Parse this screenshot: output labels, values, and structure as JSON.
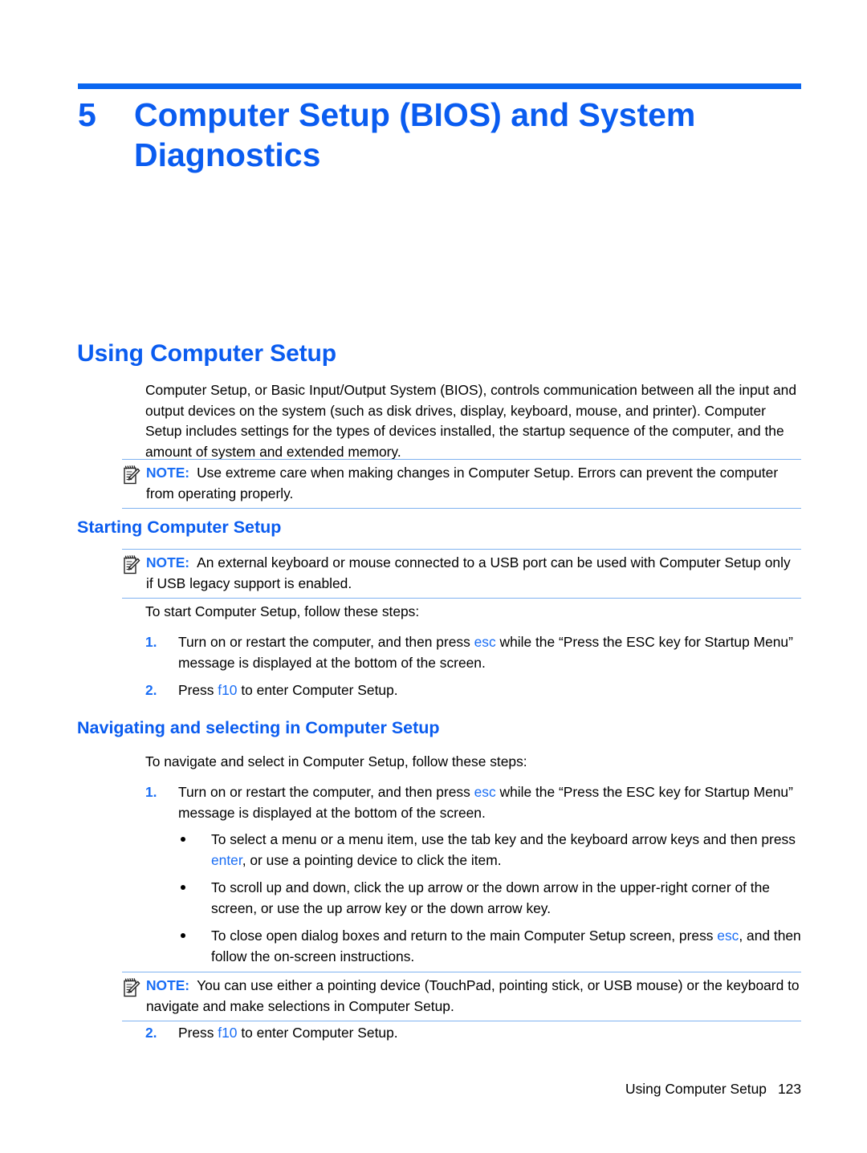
{
  "chapter": {
    "number": "5",
    "title": "Computer Setup (BIOS) and System Diagnostics"
  },
  "headings": {
    "using_computer_setup": "Using Computer Setup",
    "starting_computer_setup": "Starting Computer Setup",
    "navigating_and_selecting": "Navigating and selecting in Computer Setup"
  },
  "intro_paragraph": "Computer Setup, or Basic Input/Output System (BIOS), controls communication between all the input and output devices on the system (such as disk drives, display, keyboard, mouse, and printer). Computer Setup includes settings for the types of devices installed, the startup sequence of the computer, and the amount of system and extended memory.",
  "notes": {
    "label": "NOTE:",
    "note1": "Use extreme care when making changes in Computer Setup. Errors can prevent the computer from operating properly.",
    "note2": "An external keyboard or mouse connected to a USB port can be used with Computer Setup only if USB legacy support is enabled.",
    "note3": "You can use either a pointing device (TouchPad, pointing stick, or USB mouse) or the keyboard to navigate and make selections in Computer Setup."
  },
  "starting": {
    "lead_in": "To start Computer Setup, follow these steps:",
    "step1": {
      "num": "1.",
      "part_a": "Turn on or restart the computer, and then press ",
      "key": "esc",
      "part_b": " while the “Press the ESC key for Startup Menu” message is displayed at the bottom of the screen."
    },
    "step2": {
      "num": "2.",
      "part_a": "Press ",
      "key": "f10",
      "part_b": " to enter Computer Setup."
    }
  },
  "navigating": {
    "lead_in": "To navigate and select in Computer Setup, follow these steps:",
    "step1": {
      "num": "1.",
      "part_a": "Turn on or restart the computer, and then press ",
      "key": "esc",
      "part_b": " while the “Press the ESC key for Startup Menu” message is displayed at the bottom of the screen."
    },
    "bullets": [
      {
        "part_a": "To select a menu or a menu item, use the tab key and the keyboard arrow keys and then press ",
        "key": "enter",
        "part_b": ", or use a pointing device to click the item."
      },
      {
        "part_a": "To scroll up and down, click the up arrow or the down arrow in the upper-right corner of the screen, or use the up arrow key or the down arrow key.",
        "key": "",
        "part_b": ""
      },
      {
        "part_a": "To close open dialog boxes and return to the main Computer Setup screen, press ",
        "key": "esc",
        "part_b": ", and then follow the on-screen instructions."
      }
    ],
    "step2": {
      "num": "2.",
      "part_a": "Press ",
      "key": "f10",
      "part_b": " to enter Computer Setup."
    }
  },
  "footer": {
    "running_head": "Using Computer Setup",
    "page_number": "123"
  },
  "colors": {
    "heading_blue": "#0a5cf0",
    "key_blue": "#1a6ef5",
    "rule_blue": "#7fb2f0"
  }
}
